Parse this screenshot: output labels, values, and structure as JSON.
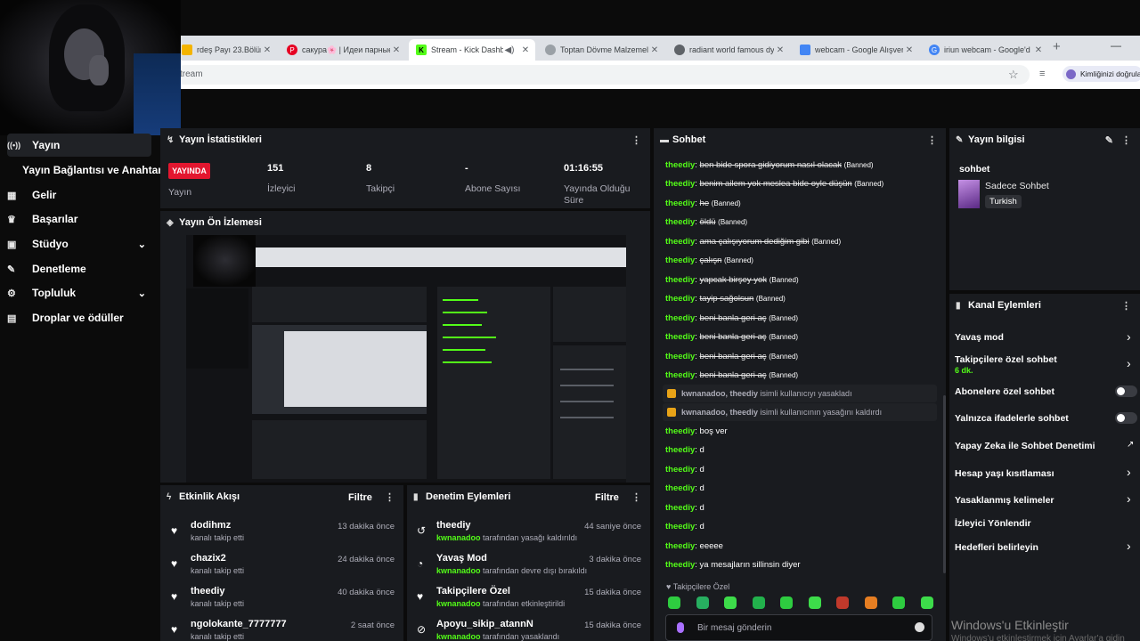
{
  "browser": {
    "tabs": [
      {
        "title": "rdeş Payı 23.Bölüm (Biz",
        "fav": "#f4b400"
      },
      {
        "title": "сакура🌸 | Идеи парные",
        "fav": "#e60023"
      },
      {
        "title": "Stream - Kick Dashbo",
        "fav": "#53fc18"
      },
      {
        "title": "Toptan Dövme Malzemel",
        "fav": "#9aa0a6"
      },
      {
        "title": "radiant world famous dy",
        "fav": "#5f6368"
      },
      {
        "title": "webcam - Google Alışver",
        "fav": "#4285f4"
      },
      {
        "title": "iriun webcam - Google'd",
        "fav": "#4285f4"
      }
    ],
    "address": "tream",
    "verify_label": "Kimliğinizi doğrula"
  },
  "sidebar": {
    "items": [
      {
        "label": "Yayın",
        "icon": "broadcast-icon",
        "glyph": "((•))"
      },
      {
        "label": "Gelir",
        "icon": "chart-icon",
        "glyph": "▦"
      },
      {
        "label": "Başarılar",
        "icon": "trophy-icon",
        "glyph": "♛"
      },
      {
        "label": "Stüdyo",
        "icon": "studio-icon",
        "glyph": "▣"
      },
      {
        "label": "Denetleme",
        "icon": "wrench-icon",
        "glyph": "✎"
      },
      {
        "label": "Topluluk",
        "icon": "community-icon",
        "glyph": "⚙"
      },
      {
        "label": "Droplar ve ödüller",
        "icon": "gift-icon",
        "glyph": "▤"
      }
    ],
    "sub_item": "Yayın Bağlantısı ve Anahtarı"
  },
  "stats": {
    "title": "Yayın İstatistikleri",
    "live_badge": "YAYINDA",
    "status_label": "Yayın",
    "viewers": "151",
    "viewers_label": "İzleyici",
    "followers": "8",
    "followers_label": "Takipçi",
    "subs": "-",
    "subs_label": "Abone Sayısı",
    "duration": "01:16:55",
    "duration_label": "Yayında Olduğu Süre"
  },
  "preview": {
    "title": "Yayın Ön İzlemesi"
  },
  "events": {
    "title": "Etkinlik Akışı",
    "filter": "Filtre",
    "items": [
      {
        "name": "dodihmz",
        "sub": "kanalı takip etti",
        "time": "13 dakika önce"
      },
      {
        "name": "chazix2",
        "sub": "kanalı takip etti",
        "time": "24 dakika önce"
      },
      {
        "name": "theediy",
        "sub": "kanalı takip etti",
        "time": "40 dakika önce"
      },
      {
        "name": "ngolokante_7777777",
        "sub": "kanalı takip etti",
        "time": "2 saat önce"
      }
    ]
  },
  "moderation": {
    "title": "Denetim Eylemleri",
    "filter": "Filtre",
    "items": [
      {
        "name": "theediy",
        "mod": "kwnanadoo",
        "sub": "tarafından yasağı kaldırıldı",
        "time": "44 saniye önce",
        "icon": "undo-icon",
        "glyph": "↺"
      },
      {
        "name": "Yavaş Mod",
        "mod": "kwnanadoo",
        "sub": "tarafından devre dışı bırakıldı",
        "time": "3 dakika önce",
        "icon": "slow-mode-icon",
        "glyph": "◔"
      },
      {
        "name": "Takipçilere Özel",
        "mod": "kwnanadoo",
        "sub": "tarafından etkinleştirildi",
        "time": "15 dakika önce",
        "icon": "heart-icon",
        "glyph": "♥"
      },
      {
        "name": "Apoyu_sikip_atannN",
        "mod": "kwnanadoo",
        "sub": "tarafından yasaklandı",
        "time": "15 dakika önce",
        "icon": "ban-icon",
        "glyph": "⊘"
      }
    ]
  },
  "chat": {
    "title": "Sohbet",
    "messages": [
      {
        "user": "theediy",
        "text": "ben bide spora gidiyorum nasıl olacak",
        "struck": true,
        "tag": "(Banned)"
      },
      {
        "user": "theediy",
        "text": "benim ailem yok meslea bide oyle düşün",
        "struck": true,
        "tag": "(Banned)"
      },
      {
        "user": "theediy",
        "text": "he",
        "struck": true,
        "tag": "(Banned)"
      },
      {
        "user": "theediy",
        "text": "öldü",
        "struck": true,
        "tag": "(Banned)"
      },
      {
        "user": "theediy",
        "text": "ama çalışıyorum dediğim gibi",
        "struck": true,
        "tag": "(Banned)"
      },
      {
        "user": "theediy",
        "text": "çalışn",
        "struck": true,
        "tag": "(Banned)"
      },
      {
        "user": "theediy",
        "text": "yapcak birşey yok",
        "struck": true,
        "tag": "(Banned)"
      },
      {
        "user": "theediy",
        "text": "tayip sağolsun",
        "struck": true,
        "tag": "(Banned)"
      },
      {
        "user": "theediy",
        "text": "beni banla geri aç",
        "struck": true,
        "tag": "(Banned)"
      },
      {
        "user": "theediy",
        "text": "beni banla geri aç",
        "struck": true,
        "tag": "(Banned)"
      },
      {
        "user": "theediy",
        "text": "beni banla geri aç",
        "struck": true,
        "tag": "(Banned)"
      },
      {
        "user": "theediy",
        "text": "beni banla geri aç",
        "struck": true,
        "tag": "(Banned)"
      }
    ],
    "mod_notices": [
      {
        "text": "kwnanadoo, theediy",
        "rest": "isimli kullanıcıyı yasakladı"
      },
      {
        "text": "kwnanadoo, theediy",
        "rest": "isimli kullanıcının yasağını kaldırdı"
      }
    ],
    "messages2": [
      {
        "user": "theediy",
        "text": "boş ver"
      },
      {
        "user": "theediy",
        "text": "d"
      },
      {
        "user": "theediy",
        "text": "d"
      },
      {
        "user": "theediy",
        "text": "d"
      },
      {
        "user": "theediy",
        "text": "d"
      },
      {
        "user": "theediy",
        "text": "d"
      },
      {
        "user": "theediy",
        "text": "eeeee"
      },
      {
        "user": "theediy",
        "text": "ya mesajların sillinsin diyer"
      }
    ],
    "mode_label": "Takipçilere Özel",
    "input_placeholder": "Bir mesaj gönderin",
    "emote_colors": [
      "#2ecc40",
      "#27ae60",
      "#3ddc4a",
      "#22b14c",
      "#2ecc40",
      "#3ddc4a",
      "#c0392b",
      "#e67e22",
      "#2ecc40",
      "#3ddc4a"
    ]
  },
  "info": {
    "title": "Yayın bilgisi",
    "stream_title": "sohbet",
    "category": "Sadece Sohbet",
    "language": "Turkish"
  },
  "actions": {
    "title": "Kanal Eylemleri",
    "items": [
      {
        "label": "Yavaş mod",
        "extra": "",
        "control": "arrow"
      },
      {
        "label": "Takipçilere özel sohbet",
        "extra": "6 dk.",
        "control": "arrow"
      },
      {
        "label": "Abonelere özel sohbet",
        "extra": "",
        "control": "toggle"
      },
      {
        "label": "Yalnızca ifadelerle sohbet",
        "extra": "",
        "control": "toggle"
      },
      {
        "label": "Yapay Zeka ile Sohbet Denetimi",
        "extra": "",
        "control": "external"
      },
      {
        "label": "Hesap yaşı kısıtlaması",
        "extra": "",
        "control": "arrow"
      },
      {
        "label": "Yasaklanmış kelimeler",
        "extra": "",
        "control": "arrow"
      },
      {
        "label": "İzleyici Yönlendir",
        "extra": "",
        "control": "none"
      },
      {
        "label": "Hedefleri belirleyin",
        "extra": "",
        "control": "arrow"
      }
    ]
  },
  "watermark": {
    "line1": "Windows'u Etkinleştir",
    "line2": "Windows'u etkinleştirmek için Ayarlar'a gidin"
  }
}
